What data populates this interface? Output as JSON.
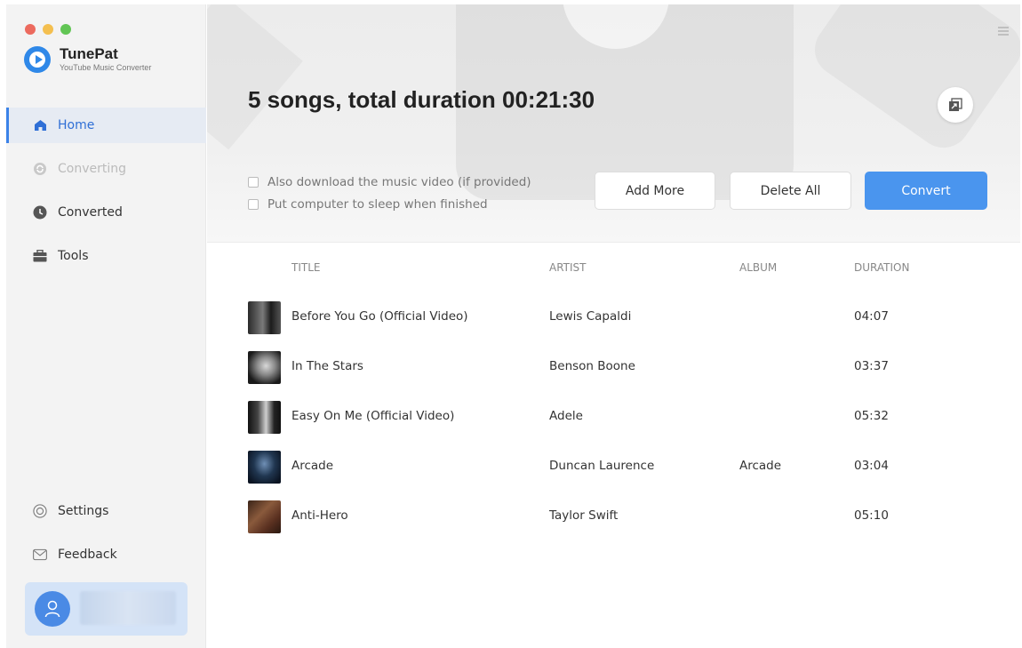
{
  "app": {
    "name": "TunePat",
    "subtitle": "YouTube Music Converter"
  },
  "sidebar": {
    "items": [
      {
        "label": "Home",
        "icon": "home-icon",
        "state": "active"
      },
      {
        "label": "Converting",
        "icon": "converting-icon",
        "state": "disabled"
      },
      {
        "label": "Converted",
        "icon": "clock-icon",
        "state": "normal"
      },
      {
        "label": "Tools",
        "icon": "toolbox-icon",
        "state": "normal"
      }
    ],
    "bottom_items": [
      {
        "label": "Settings",
        "icon": "settings-icon"
      },
      {
        "label": "Feedback",
        "icon": "mail-icon"
      }
    ]
  },
  "header": {
    "title": "5 songs, total duration 00:21:30"
  },
  "options": {
    "download_video": "Also download the music video (if provided)",
    "sleep_when_finished": "Put computer to sleep when finished"
  },
  "buttons": {
    "add_more": "Add More",
    "delete_all": "Delete All",
    "convert": "Convert"
  },
  "table": {
    "columns": {
      "title": "TITLE",
      "artist": "ARTIST",
      "album": "ALBUM",
      "duration": "DURATION"
    },
    "rows": [
      {
        "title": "Before You Go (Official Video)",
        "artist": "Lewis Capaldi",
        "album": "",
        "duration": "04:07"
      },
      {
        "title": "In The Stars",
        "artist": "Benson Boone",
        "album": "",
        "duration": "03:37"
      },
      {
        "title": "Easy On Me (Official Video)",
        "artist": "Adele",
        "album": "",
        "duration": "05:32"
      },
      {
        "title": "Arcade",
        "artist": "Duncan Laurence",
        "album": "Arcade",
        "duration": "03:04"
      },
      {
        "title": "Anti-Hero",
        "artist": "Taylor Swift",
        "album": "",
        "duration": "05:10"
      }
    ]
  },
  "colors": {
    "accent": "#4a95ee",
    "active_nav": "#2f6fd6",
    "sidebar_bg": "#f3f3f3"
  }
}
